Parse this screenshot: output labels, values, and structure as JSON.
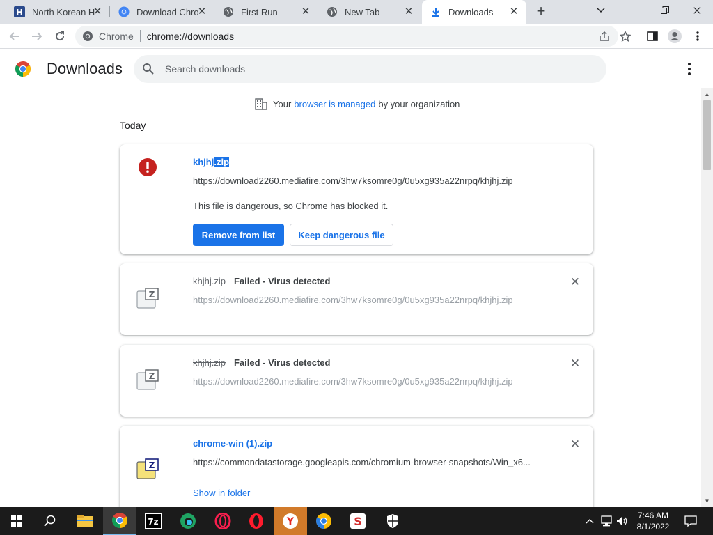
{
  "tabs": [
    {
      "title": "North Korean H",
      "favicon": "h-letter-icon",
      "active": false
    },
    {
      "title": "Download Chro",
      "favicon": "chrome-icon",
      "active": false
    },
    {
      "title": "First Run",
      "favicon": "globe-icon",
      "active": false
    },
    {
      "title": "New Tab",
      "favicon": "globe-icon",
      "active": false
    },
    {
      "title": "Downloads",
      "favicon": "download-arrow-icon",
      "active": true
    }
  ],
  "omnibox": {
    "site": "Chrome",
    "url": "chrome://downloads"
  },
  "header": {
    "title": "Downloads",
    "search_placeholder": "Search downloads"
  },
  "managed": {
    "prefix": "Your",
    "link": "browser is managed",
    "suffix": "by your organization"
  },
  "section": "Today",
  "downloads": [
    {
      "name": "khjhj.zip",
      "name_plain": "khjhj",
      "name_selected": ".zip",
      "url": "https://download2260.mediafire.com/3hw7ksomre0g/0u5xg935a22nrpq/khjhj.zip",
      "description": "This file is dangerous, so Chrome has blocked it.",
      "primary_action": "Remove from list",
      "secondary_action": "Keep dangerous file"
    },
    {
      "name": "khjhj.zip",
      "status": "Failed - Virus detected",
      "url": "https://download2260.mediafire.com/3hw7ksomre0g/0u5xg935a22nrpq/khjhj.zip"
    },
    {
      "name": "khjhj.zip",
      "status": "Failed - Virus detected",
      "url": "https://download2260.mediafire.com/3hw7ksomre0g/0u5xg935a22nrpq/khjhj.zip"
    },
    {
      "name": "chrome-win (1).zip",
      "url": "https://commondatastorage.googleapis.com/chromium-browser-snapshots/Win_x6...",
      "action": "Show in folder"
    }
  ],
  "taskbar": {
    "apps": [
      "start-icon",
      "search-icon",
      "file-explorer-icon",
      "chrome-icon",
      "7zip-icon",
      "edge-icon",
      "opera-gx-icon",
      "opera-icon",
      "yandex-icon",
      "chromium-icon",
      "snapfiles-icon",
      "security-shield-icon"
    ],
    "time": "7:46 AM",
    "date": "8/1/2022"
  },
  "colors": {
    "accent": "#1a73e8",
    "danger": "#c5221f",
    "tabstrip": "#dee1e6",
    "taskbar": "#1b1b1b"
  }
}
